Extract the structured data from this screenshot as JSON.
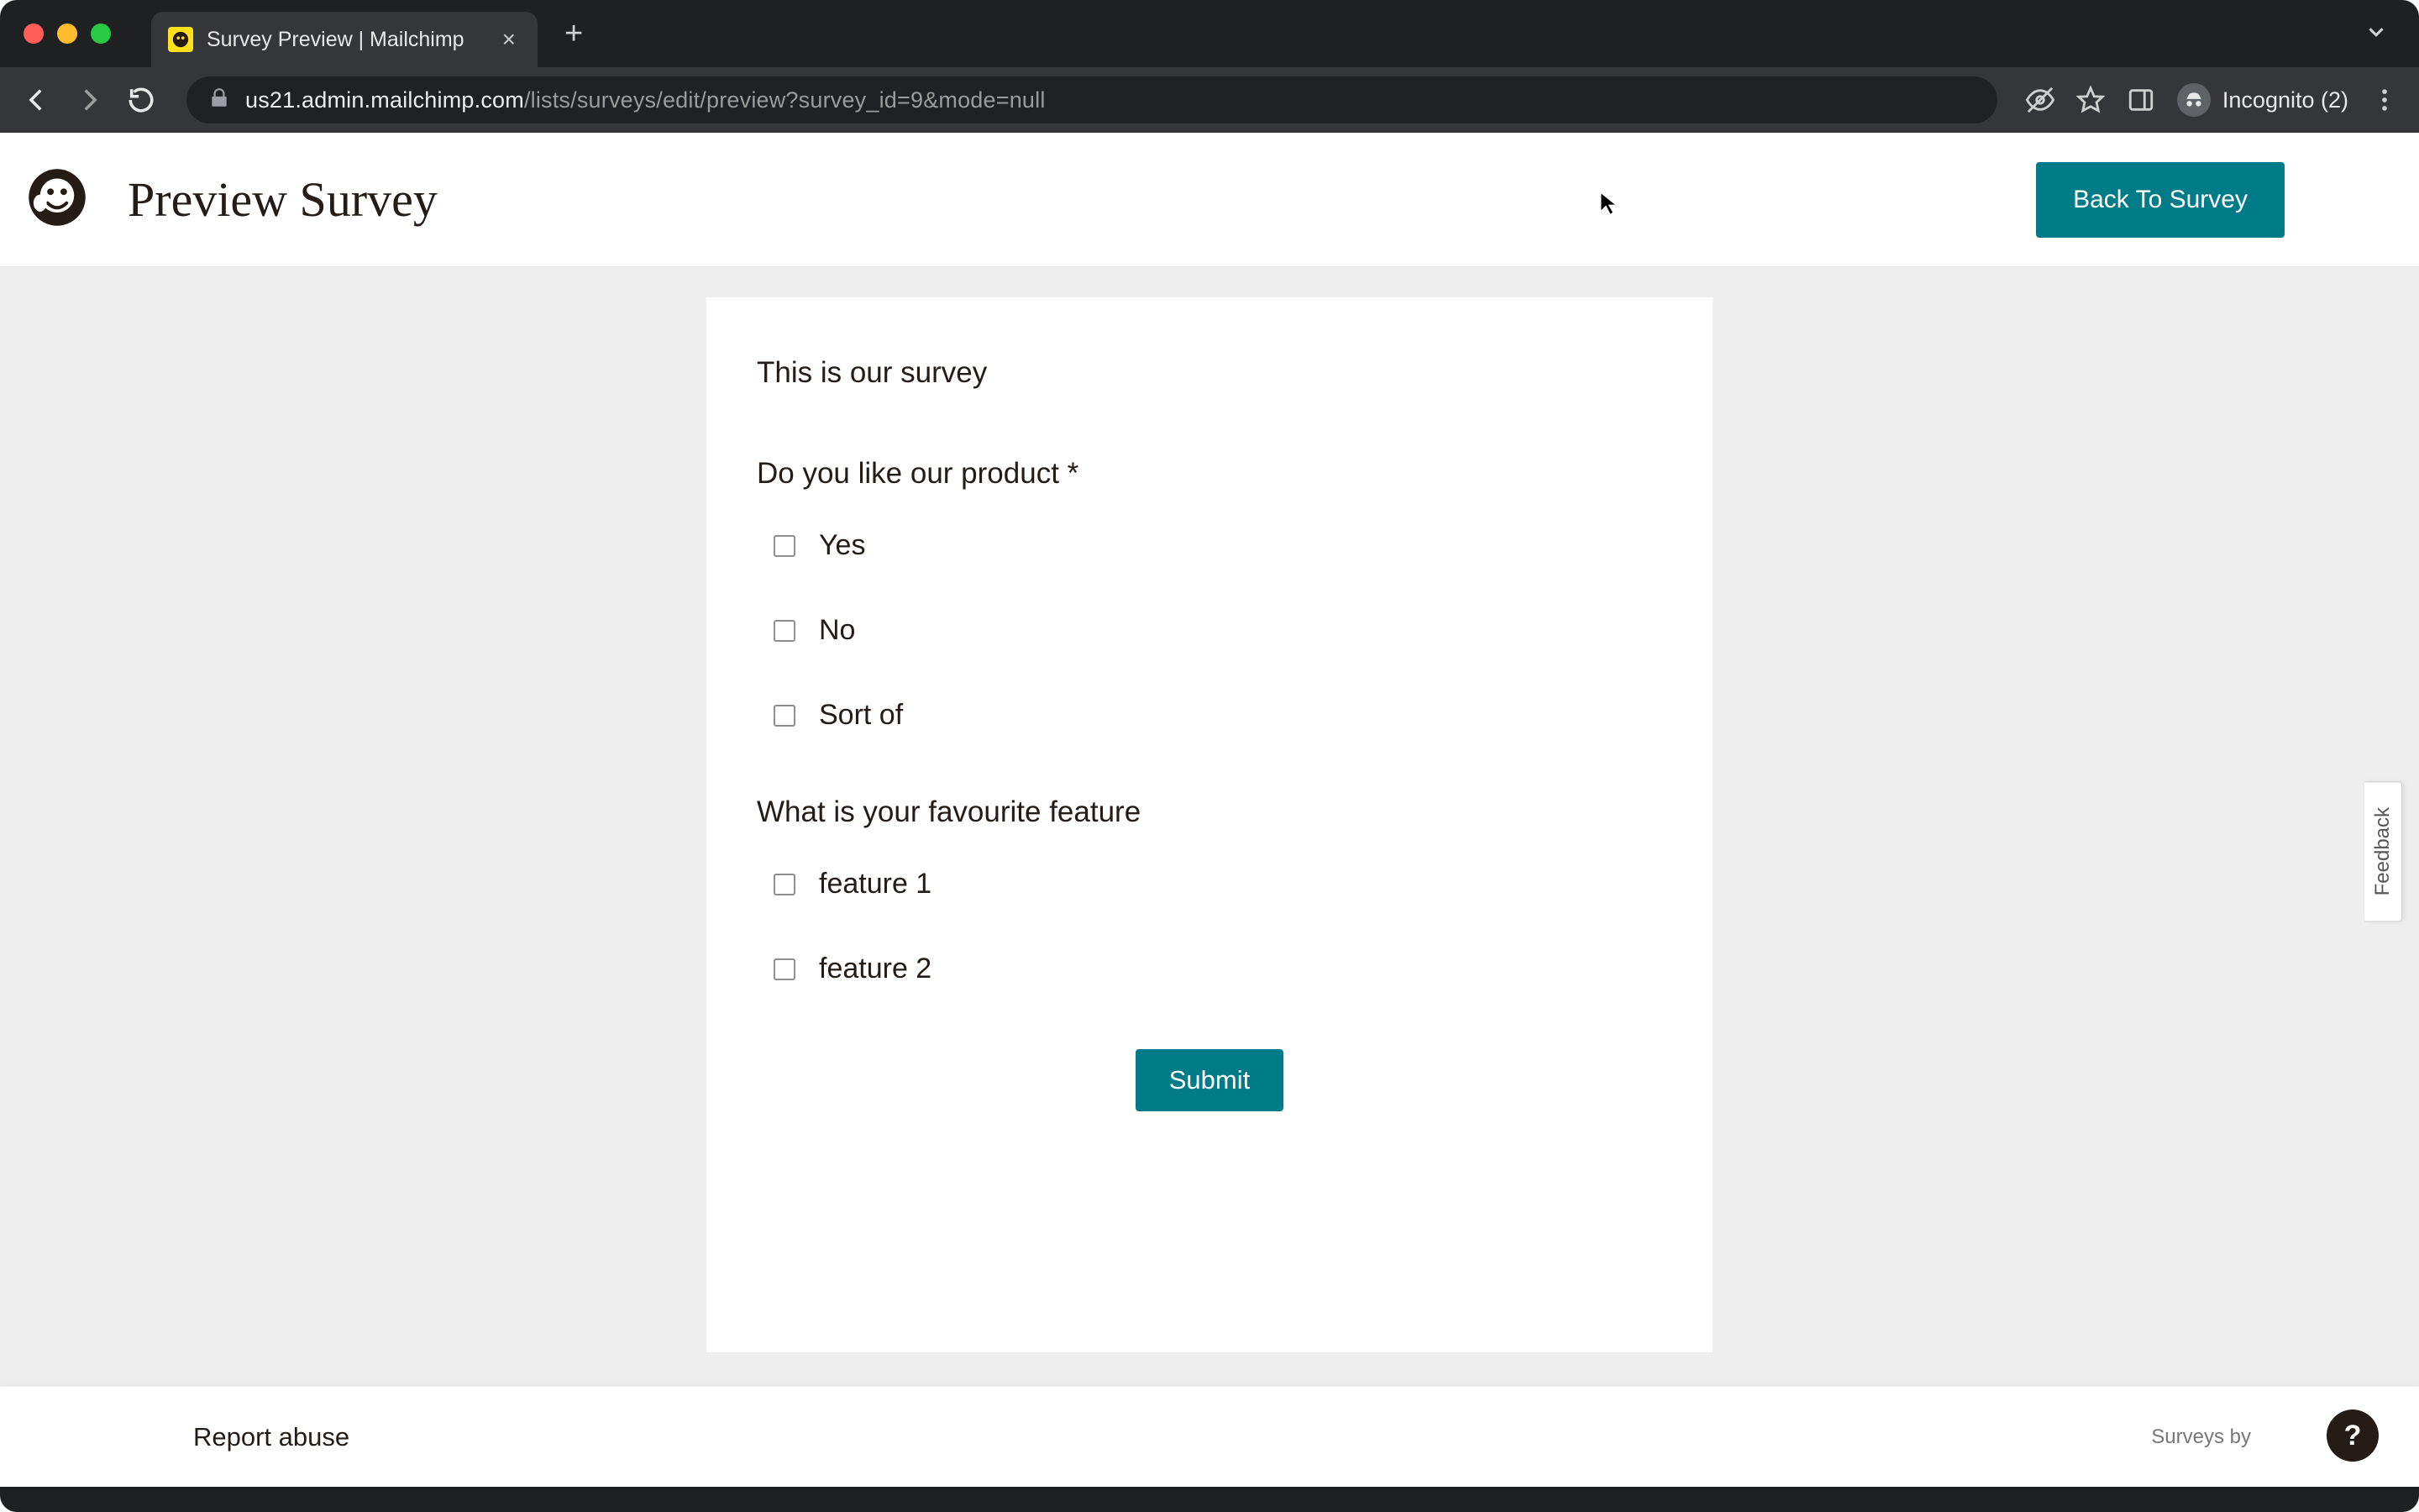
{
  "browser": {
    "tab_title": "Survey Preview | Mailchimp",
    "url_host": "us21.admin.mailchimp.com",
    "url_path": "/lists/surveys/edit/preview?survey_id=9&mode=null",
    "incognito_label": "Incognito (2)"
  },
  "header": {
    "title": "Preview Survey",
    "back_button": "Back To Survey"
  },
  "survey": {
    "title": "This is our survey",
    "questions": [
      {
        "text": "Do you like our product",
        "required": true,
        "options": [
          "Yes",
          "No",
          "Sort of"
        ]
      },
      {
        "text": "What is your favourite feature",
        "required": false,
        "options": [
          "feature 1",
          "feature 2"
        ]
      }
    ],
    "submit_label": "Submit"
  },
  "feedback_tab": "Feedback",
  "footer": {
    "report_abuse": "Report abuse",
    "surveys_by": "Surveys by"
  },
  "help_fab": "?"
}
